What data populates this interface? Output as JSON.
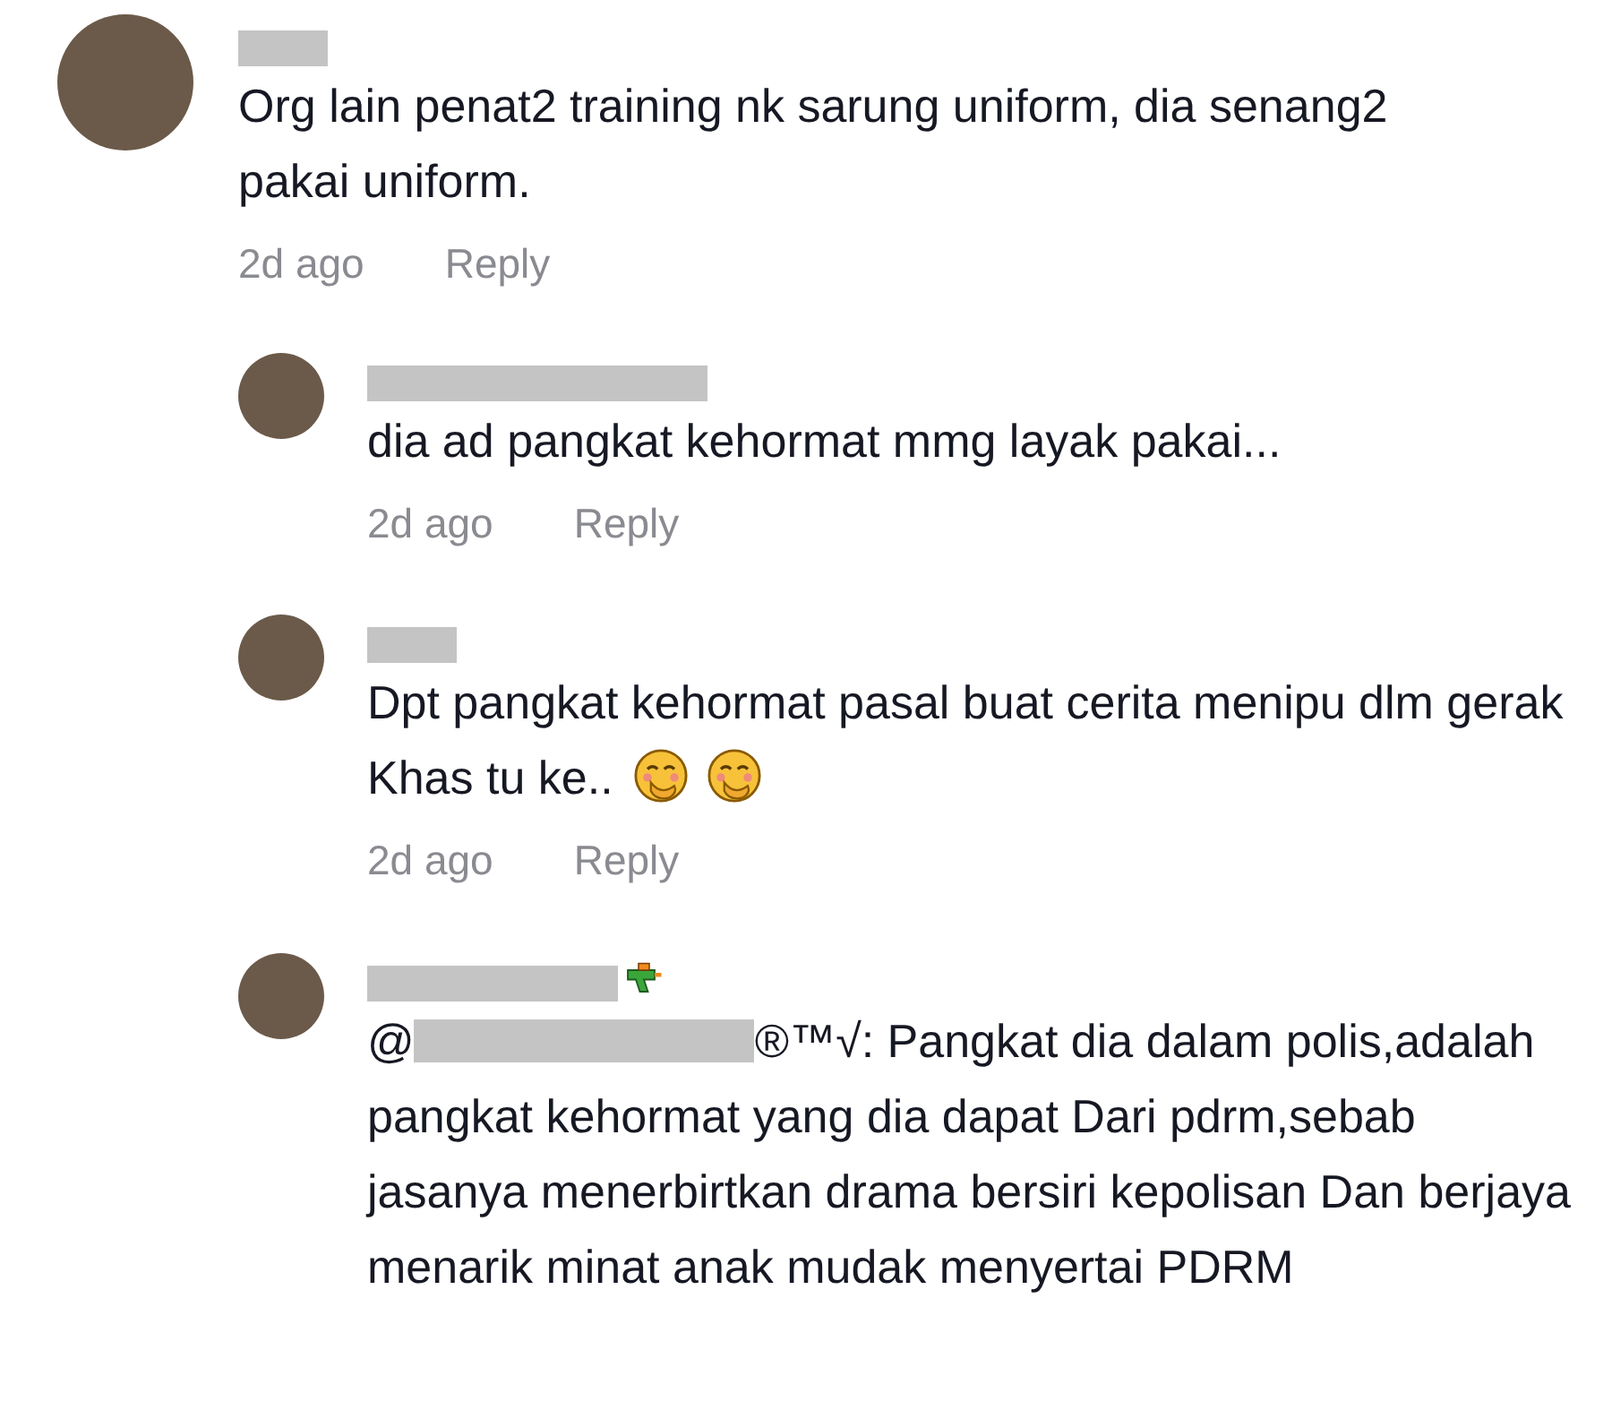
{
  "comments": [
    {
      "name_redacted": true,
      "text": "Org lain penat2 training nk sarung uniform, dia senang2 pakai uniform.",
      "time": "2d ago",
      "reply_label": "Reply",
      "replies": [
        {
          "name_redacted": true,
          "text": "dia ad pangkat kehormat mmg layak pakai...",
          "time": "2d ago",
          "reply_label": "Reply"
        },
        {
          "name_redacted": true,
          "text": "Dpt pangkat kehormat pasal buat cerita menipu dlm gerak Khas tu ke..",
          "reactions": [
            {
              "kind": "hand-over-mouth"
            },
            {
              "kind": "hand-over-mouth"
            }
          ],
          "time": "2d ago",
          "reply_label": "Reply"
        },
        {
          "name_redacted": true,
          "badge": {
            "kind": "water-gun"
          },
          "mention": {
            "prefix": "@",
            "suffix": "®™√"
          },
          "text": ": Pangkat dia dalam polis,adalah pangkat kehormat yang dia dapat Dari pdrm,sebab jasanya menerbirtkan drama bersiri kepolisan Dan berjaya menarik minat anak mudak menyertai PDRM"
        }
      ]
    }
  ]
}
